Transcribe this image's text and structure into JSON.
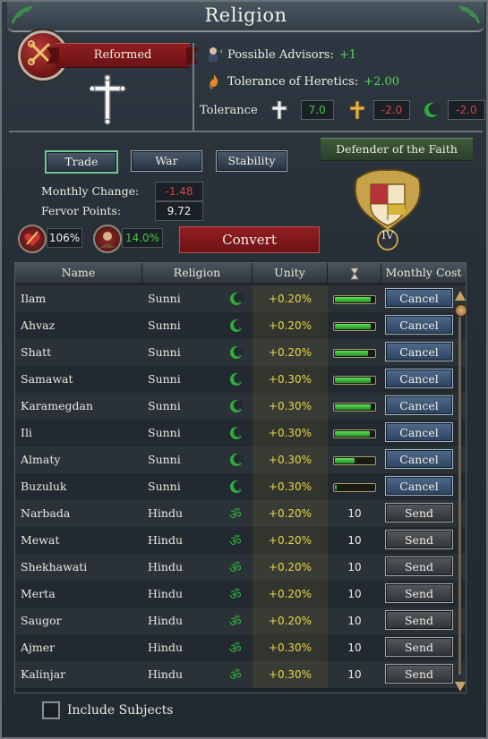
{
  "window": {
    "title": "Religion"
  },
  "religion": {
    "name": "Reformed",
    "possible_advisors_label": "Possible Advisors:",
    "possible_advisors_value": "+1",
    "tolerance_heretics_label": "Tolerance of Heretics:",
    "tolerance_heretics_value": "+2.00",
    "tolerance_label": "Tolerance",
    "tolerance_values": [
      "7.0",
      "-2.0",
      "-2.0"
    ]
  },
  "mission_tabs": [
    {
      "label": "Trade",
      "selected": true
    },
    {
      "label": "War",
      "selected": false
    },
    {
      "label": "Stability",
      "selected": false
    }
  ],
  "stats": {
    "monthly_change_label": "Monthly Change:",
    "monthly_change_value": "-1.48",
    "fervor_points_label": "Fervor Points:",
    "fervor_points_value": "9.72"
  },
  "defender": {
    "label": "Defender of the Faith",
    "level": "IV"
  },
  "conversion": {
    "percent_a": "106%",
    "percent_b": "14.0%",
    "convert_label": "Convert"
  },
  "table": {
    "headers": {
      "name": "Name",
      "religion": "Religion",
      "unity": "Unity",
      "time_icon": "hourglass-icon",
      "cost": "Monthly Cost"
    },
    "rows": [
      {
        "name": "Ilam",
        "religion": "Sunni",
        "icon": "crescent-icon",
        "unity": "+0.20%",
        "progress": 0.9,
        "time": "",
        "action": "Cancel"
      },
      {
        "name": "Ahvaz",
        "religion": "Sunni",
        "icon": "crescent-icon",
        "unity": "+0.20%",
        "progress": 0.9,
        "time": "",
        "action": "Cancel"
      },
      {
        "name": "Shatt",
        "religion": "Sunni",
        "icon": "crescent-icon",
        "unity": "+0.20%",
        "progress": 0.85,
        "time": "",
        "action": "Cancel"
      },
      {
        "name": "Samawat",
        "religion": "Sunni",
        "icon": "crescent-icon",
        "unity": "+0.30%",
        "progress": 0.9,
        "time": "",
        "action": "Cancel"
      },
      {
        "name": "Karamegdan",
        "religion": "Sunni",
        "icon": "crescent-icon",
        "unity": "+0.30%",
        "progress": 0.9,
        "time": "",
        "action": "Cancel"
      },
      {
        "name": "Ili",
        "religion": "Sunni",
        "icon": "crescent-icon",
        "unity": "+0.30%",
        "progress": 0.88,
        "time": "",
        "action": "Cancel"
      },
      {
        "name": "Almaty",
        "religion": "Sunni",
        "icon": "crescent-icon",
        "unity": "+0.30%",
        "progress": 0.5,
        "time": "",
        "action": "Cancel"
      },
      {
        "name": "Buzuluk",
        "religion": "Sunni",
        "icon": "crescent-icon",
        "unity": "+0.30%",
        "progress": 0.05,
        "time": "",
        "action": "Cancel"
      },
      {
        "name": "Narbada",
        "religion": "Hindu",
        "icon": "om-icon",
        "unity": "+0.20%",
        "progress": null,
        "time": "10",
        "action": "Send"
      },
      {
        "name": "Mewat",
        "religion": "Hindu",
        "icon": "om-icon",
        "unity": "+0.20%",
        "progress": null,
        "time": "10",
        "action": "Send"
      },
      {
        "name": "Shekhawati",
        "religion": "Hindu",
        "icon": "om-icon",
        "unity": "+0.20%",
        "progress": null,
        "time": "10",
        "action": "Send"
      },
      {
        "name": "Merta",
        "religion": "Hindu",
        "icon": "om-icon",
        "unity": "+0.20%",
        "progress": null,
        "time": "10",
        "action": "Send"
      },
      {
        "name": "Saugor",
        "religion": "Hindu",
        "icon": "om-icon",
        "unity": "+0.20%",
        "progress": null,
        "time": "10",
        "action": "Send"
      },
      {
        "name": "Ajmer",
        "religion": "Hindu",
        "icon": "om-icon",
        "unity": "+0.30%",
        "progress": null,
        "time": "10",
        "action": "Send"
      },
      {
        "name": "Kalinjar",
        "religion": "Hindu",
        "icon": "om-icon",
        "unity": "+0.30%",
        "progress": null,
        "time": "10",
        "action": "Send"
      }
    ]
  },
  "include_subjects": {
    "label": "Include Subjects",
    "checked": false
  },
  "colors": {
    "accent_green": "#46c446",
    "negative_red": "#d04646",
    "unity_yellow": "#e9d54c",
    "ribbon_red": "#8f1f22"
  }
}
